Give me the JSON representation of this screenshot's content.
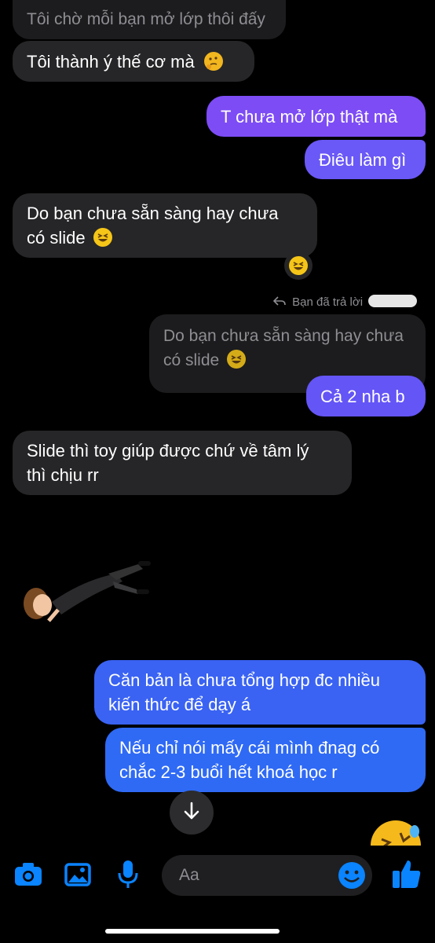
{
  "messages": {
    "m1": "Tôi chờ mỗi bạn mở lớp thôi đấy",
    "m2": "Tôi thành ý thế cơ mà",
    "m3": "T chưa mở lớp thật mà",
    "m4": "Điêu làm gì",
    "m5_line1": "Do bạn chưa sẵn sàng hay chưa",
    "m5_line2": "có slide",
    "reply_label": "Bạn đã trả lời",
    "quote_line1": "Do bạn chưa sẵn sàng hay chưa",
    "quote_line2": "có slide",
    "m6": "Cả 2 nha b",
    "m7_line1": "Slide thì toy giúp được chứ về tâm lý",
    "m7_line2": "thì chịu rr",
    "m8_line1": "Căn bản là chưa tổng hợp đc nhiều",
    "m8_line2": "kiến thức để dạy á",
    "m9_line1": "Nếu chỉ nói mấy cái mình đnag có",
    "m9_line2": "chắc 2-3 buổi hết khoá học r"
  },
  "composer": {
    "placeholder": "Aa"
  },
  "colors": {
    "incoming": "#262628",
    "outgoing_top": "#7d4cf5",
    "outgoing_bottom": "#2f6af5",
    "accent": "#0a84ff"
  }
}
